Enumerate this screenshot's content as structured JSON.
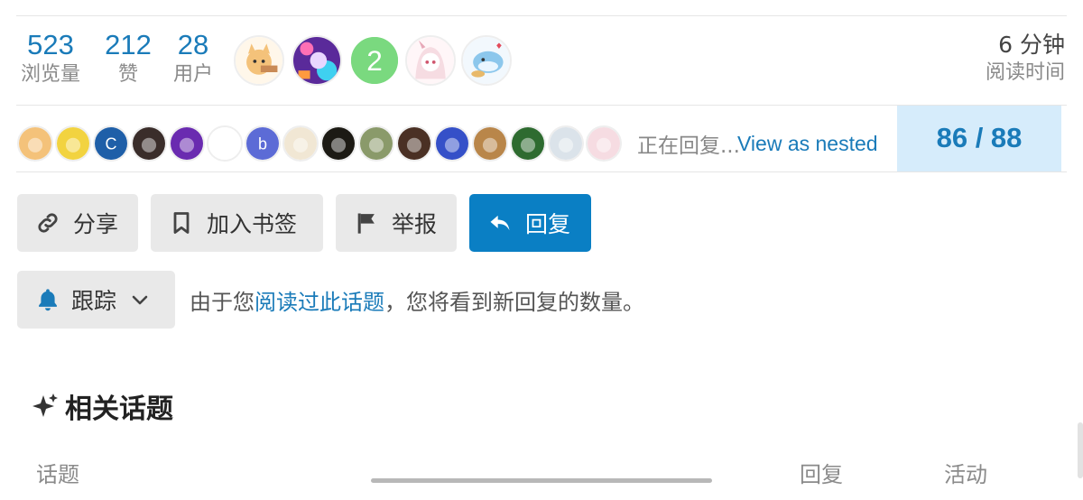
{
  "stats": {
    "views": {
      "value": "523",
      "label": "浏览量"
    },
    "likes": {
      "value": "212",
      "label": "赞"
    },
    "users": {
      "value": "28",
      "label": "用户"
    }
  },
  "top_avatars": [
    {
      "icon": "cat-avatar",
      "color": "#f4c27a"
    },
    {
      "icon": "anime-avatar",
      "color": "#8a4fd0"
    },
    {
      "icon": "letter-avatar",
      "letter": "2",
      "color": "#7ad97f"
    },
    {
      "icon": "anime-girl-avatar",
      "color": "#f6dce2"
    },
    {
      "icon": "whale-avatar",
      "color": "#bfe0f5"
    }
  ],
  "read_time": {
    "value": "6 分钟",
    "label": "阅读时间"
  },
  "repliers": {
    "avatars": [
      {
        "icon": "cat-avatar",
        "color": "#f4c27a"
      },
      {
        "icon": "pikachu-avatar",
        "color": "#f2d340"
      },
      {
        "icon": "letter-avatar",
        "letter": "C",
        "color": "#1f5fa8"
      },
      {
        "icon": "photo-avatar",
        "color": "#3a2d2a"
      },
      {
        "icon": "neon-avatar",
        "color": "#6a2bb0"
      },
      {
        "icon": "panda-avatar",
        "color": "#ffffff"
      },
      {
        "icon": "letter-avatar",
        "letter": "b",
        "color": "#5c6bd6"
      },
      {
        "icon": "anime-boy-avatar",
        "color": "#f1e7d4"
      },
      {
        "icon": "fire-avatar",
        "color": "#1c1a14"
      },
      {
        "icon": "landscape-avatar",
        "color": "#8a9a6a"
      },
      {
        "icon": "person-avatar",
        "color": "#4a3024"
      },
      {
        "icon": "blue-avatar",
        "color": "#3550c8"
      },
      {
        "icon": "guitar-avatar",
        "color": "#b9864a"
      },
      {
        "icon": "ring-avatar",
        "color": "#2e6b30"
      },
      {
        "icon": "sketch-avatar",
        "color": "#dbe3ea"
      },
      {
        "icon": "anime-girl-avatar",
        "color": "#f6dce2"
      }
    ],
    "replying_text": "正在回复...",
    "nested_link": "View as nested"
  },
  "progress": {
    "label": "86 / 88"
  },
  "actions": {
    "share": "分享",
    "bookmark": "加入书签",
    "flag": "举报",
    "reply": "回复"
  },
  "notification": {
    "level": "跟踪",
    "text_before": "由于您",
    "link": "阅读过此话题",
    "text_after": "，您将看到新回复的数量。"
  },
  "related": {
    "title": "相关话题",
    "columns": {
      "topic": "话题",
      "replies": "回复",
      "activity": "活动"
    }
  },
  "colors": {
    "accent": "#1a7bb9",
    "primary_button": "#0a7fc4",
    "progress_bg": "#d6ecfb"
  }
}
